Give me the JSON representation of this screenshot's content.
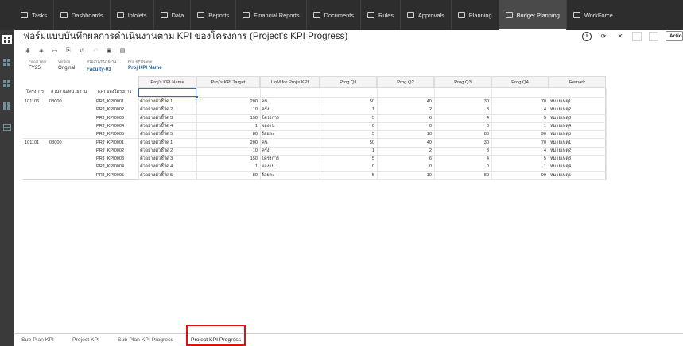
{
  "nav": {
    "items": [
      {
        "label": "Tasks",
        "icon": "tasks-icon"
      },
      {
        "label": "Dashboards",
        "icon": "dashboards-icon"
      },
      {
        "label": "Infolets",
        "icon": "infolets-icon"
      },
      {
        "label": "Data",
        "icon": "data-icon"
      },
      {
        "label": "Reports",
        "icon": "reports-icon"
      },
      {
        "label": "Financial Reports",
        "icon": "financial-reports-icon"
      },
      {
        "label": "Documents",
        "icon": "documents-icon"
      },
      {
        "label": "Rules",
        "icon": "rules-icon"
      },
      {
        "label": "Approvals",
        "icon": "approvals-icon"
      },
      {
        "label": "Planning",
        "icon": "planning-icon"
      },
      {
        "label": "Budget Planning",
        "icon": "budget-planning-icon",
        "active": true
      },
      {
        "label": "WorkForce",
        "icon": "workforce-icon"
      }
    ]
  },
  "page": {
    "title": "ฟอร์มแบบบันทึกผลการดำเนินงานตาม KPI ของโครงการ (Project's KPI Progress)",
    "actions_label": "Actions"
  },
  "pov": {
    "fiscal_year": {
      "label": "Fiscal Year",
      "value": "FY25"
    },
    "version": {
      "label": "Version",
      "value": "Original"
    },
    "entity": {
      "label": "ส่วนงาน/หน่วยงาน",
      "value": "Faculty-03"
    },
    "kpi_name": {
      "label": "Proj KPI Name",
      "value": "Proj KPI Name"
    }
  },
  "grid": {
    "row_headers": [
      "โครงการ",
      "ส่วนงาน/หน่วยงาน",
      "KPI ของโครงการ"
    ],
    "columns": [
      "Proj's KPI Name",
      "Proj's KPI Target",
      "UoM for Proj's KPI",
      "Prog Q1",
      "Prog Q2",
      "Prog Q3",
      "Prog Q4",
      "Remark"
    ],
    "groups": [
      {
        "project": "101106",
        "unit": "03000",
        "rows": [
          {
            "kpi": "PRJ_KPI0001",
            "name": "ตัวอย่างตัวชี้วัด 1",
            "target": "200",
            "uom": "คน",
            "q1": "50",
            "q2": "40",
            "q3": "30",
            "q4": "70",
            "remark": "หมายเหตุ1"
          },
          {
            "kpi": "PRJ_KPI0002",
            "name": "ตัวอย่างตัวชี้วัด 2",
            "target": "10",
            "uom": "ครั้ง",
            "q1": "1",
            "q2": "2",
            "q3": "3",
            "q4": "4",
            "remark": "หมายเหตุ2"
          },
          {
            "kpi": "PRJ_KPI0003",
            "name": "ตัวอย่างตัวชี้วัด 3",
            "target": "150",
            "uom": "โครงการ",
            "q1": "5",
            "q2": "6",
            "q3": "4",
            "q4": "5",
            "remark": "หมายเหตุ3"
          },
          {
            "kpi": "PRJ_KPI0004",
            "name": "ตัวอย่างตัวชี้วัด 4",
            "target": "1",
            "uom": "ผลงาน",
            "q1": "0",
            "q2": "0",
            "q3": "0",
            "q4": "1",
            "remark": "หมายเหตุ4"
          },
          {
            "kpi": "PRJ_KPI0005",
            "name": "ตัวอย่างตัวชี้วัด 5",
            "target": "80",
            "uom": "ร้อยละ",
            "q1": "5",
            "q2": "10",
            "q3": "80",
            "q4": "90",
            "remark": "หมายเหตุ5"
          }
        ]
      },
      {
        "project": "101101",
        "unit": "03000",
        "rows": [
          {
            "kpi": "PRJ_KPI0001",
            "name": "ตัวอย่างตัวชี้วัด 1",
            "target": "200",
            "uom": "คน",
            "q1": "50",
            "q2": "40",
            "q3": "30",
            "q4": "70",
            "remark": "หมายเหตุ1"
          },
          {
            "kpi": "PRJ_KPI0002",
            "name": "ตัวอย่างตัวชี้วัด 2",
            "target": "10",
            "uom": "ครั้ง",
            "q1": "1",
            "q2": "2",
            "q3": "3",
            "q4": "4",
            "remark": "หมายเหตุ2"
          },
          {
            "kpi": "PRJ_KPI0003",
            "name": "ตัวอย่างตัวชี้วัด 3",
            "target": "150",
            "uom": "โครงการ",
            "q1": "5",
            "q2": "6",
            "q3": "4",
            "q4": "5",
            "remark": "หมายเหตุ3"
          },
          {
            "kpi": "PRJ_KPI0004",
            "name": "ตัวอย่างตัวชี้วัด 4",
            "target": "1",
            "uom": "ผลงาน",
            "q1": "0",
            "q2": "0",
            "q3": "0",
            "q4": "1",
            "remark": "หมายเหตุ4"
          },
          {
            "kpi": "PRJ_KPI0005",
            "name": "ตัวอย่างตัวชี้วัด 5",
            "target": "80",
            "uom": "ร้อยละ",
            "q1": "5",
            "q2": "10",
            "q3": "80",
            "q4": "90",
            "remark": "หมายเหตุ5"
          }
        ]
      }
    ]
  },
  "bottom_tabs": [
    {
      "label": "Sub-Plan KPI"
    },
    {
      "label": "Project KPI"
    },
    {
      "label": "Sub-Plan KPI Progress"
    },
    {
      "label": "Project KPI Progress",
      "active": true
    }
  ],
  "colors": {
    "accent": "#2f6fb5",
    "highlight": "#e01010",
    "nav_bg": "#2d2d2d"
  }
}
